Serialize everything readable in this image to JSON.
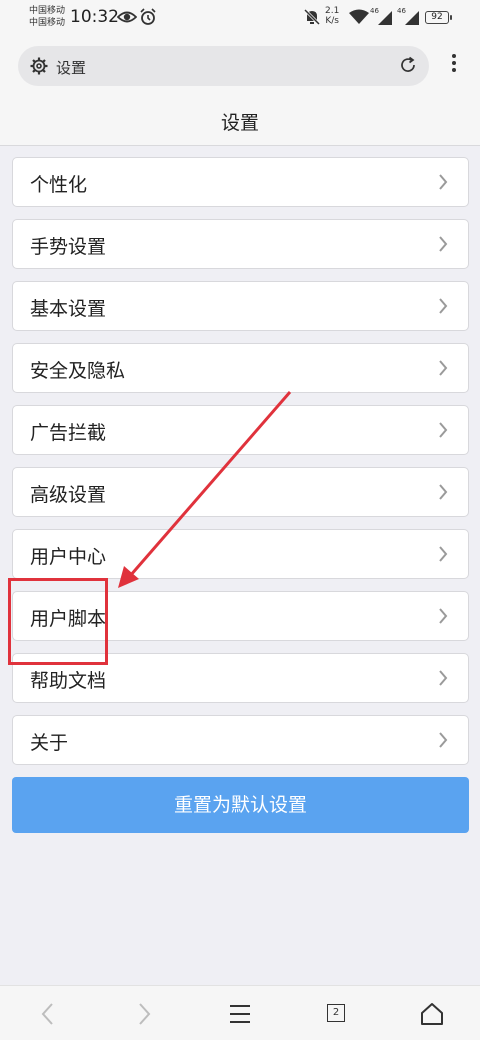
{
  "status_bar": {
    "carrier_1": "中国移动",
    "carrier_2": "中国移动",
    "time": "10:32",
    "net_speed_value": "2.1",
    "net_speed_unit": "K/s",
    "signal_1": "46",
    "signal_2": "46",
    "battery": "92",
    "icons": [
      "eye-icon",
      "alarm-icon",
      "mute-icon",
      "wifi-icon",
      "signal-icon",
      "signal-icon",
      "battery-icon"
    ]
  },
  "browser": {
    "url_text": "设置",
    "icons": [
      "gear-icon",
      "refresh-icon",
      "more-vert-icon"
    ]
  },
  "page": {
    "title": "设置"
  },
  "settings_items": [
    {
      "label": "个性化"
    },
    {
      "label": "手势设置"
    },
    {
      "label": "基本设置"
    },
    {
      "label": "安全及隐私"
    },
    {
      "label": "广告拦截"
    },
    {
      "label": "高级设置"
    },
    {
      "label": "用户中心"
    },
    {
      "label": "用户脚本"
    },
    {
      "label": "帮助文档"
    },
    {
      "label": "关于"
    }
  ],
  "reset_button": "重置为默认设置",
  "bottom_nav": {
    "tabs_count": "2",
    "icons": [
      "back-icon",
      "forward-icon",
      "menu-icon",
      "tabs-icon",
      "home-icon"
    ]
  },
  "colors": {
    "accent": "#5aa3f0",
    "annotation": "#e0323c",
    "background": "#efeff4"
  }
}
